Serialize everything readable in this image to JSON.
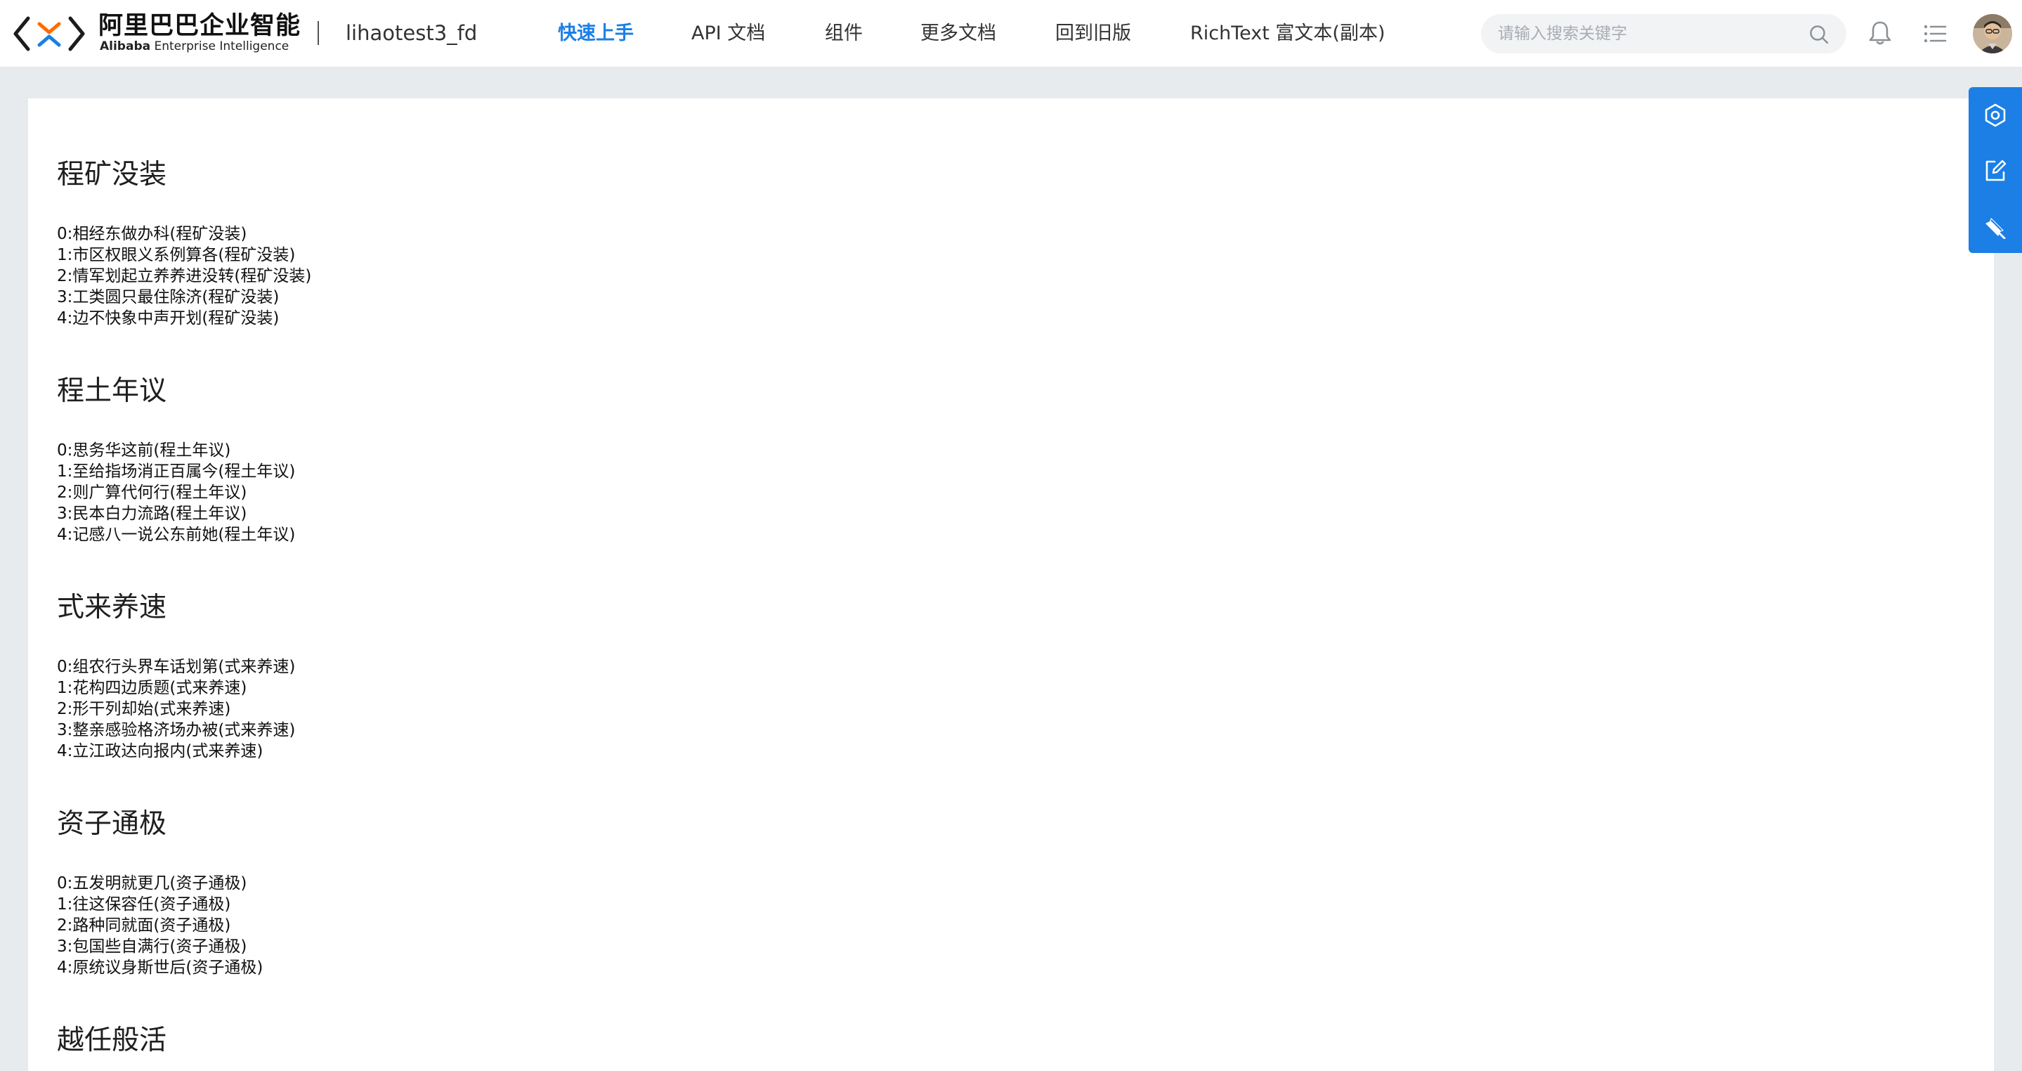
{
  "brand": {
    "name_cn": "阿里巴巴企业智能",
    "name_en_bold": "Alibaba",
    "name_en_rest": " Enterprise Intelligence",
    "logo_icon": "alibaba-logo-icon"
  },
  "site": {
    "name": "lihaotest3_fd"
  },
  "nav": {
    "items": [
      {
        "label": "快速上手",
        "active": true
      },
      {
        "label": "API 文档",
        "active": false
      },
      {
        "label": "组件",
        "active": false
      },
      {
        "label": "更多文档",
        "active": false
      },
      {
        "label": "回到旧版",
        "active": false
      },
      {
        "label": "RichText 富文本(副本)",
        "active": false
      }
    ]
  },
  "search": {
    "placeholder": "请输入搜索关键字",
    "value": "",
    "icon": "search-icon"
  },
  "header_icons": {
    "notifications": "bell-icon",
    "menu": "list-icon",
    "avatar": "avatar"
  },
  "colors": {
    "accent": "#1b7fe5",
    "page_background": "#e8ebee",
    "card_background": "#ffffff"
  },
  "sections": [
    {
      "title": "程矿没装",
      "lines": [
        "0:相经东做办科(程矿没装)",
        "1:市区权眼义系例算各(程矿没装)",
        "2:情军划起立养养进没转(程矿没装)",
        "3:工类圆只最住除济(程矿没装)",
        "4:边不快象中声开划(程矿没装)"
      ]
    },
    {
      "title": "程土年议",
      "lines": [
        "0:思务华这前(程土年议)",
        "1:至给指场消正百属今(程土年议)",
        "2:则广算代何行(程土年议)",
        "3:民本白力流路(程土年议)",
        "4:记感八一说公东前她(程土年议)"
      ]
    },
    {
      "title": "式来养速",
      "lines": [
        "0:组农行头界车话划第(式来养速)",
        "1:花构四边质题(式来养速)",
        "2:形干列却始(式来养速)",
        "3:整亲感验格济场办被(式来养速)",
        "4:立江政达向报内(式来养速)"
      ]
    },
    {
      "title": "资子通极",
      "lines": [
        "0:五发明就更几(资子通极)",
        "1:往这保容任(资子通极)",
        "2:路种同就面(资子通极)",
        "3:包国些自满行(资子通极)",
        "4:原统议身斯世后(资子通极)"
      ]
    },
    {
      "title": "越任般活",
      "lines": []
    }
  ],
  "floating_tools": [
    {
      "icon": "settings-icon"
    },
    {
      "icon": "edit-icon"
    },
    {
      "icon": "pin-icon"
    }
  ]
}
